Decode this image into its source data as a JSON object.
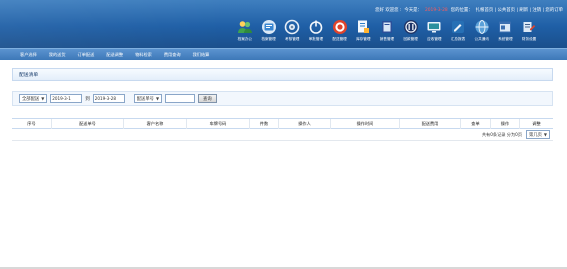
{
  "header": {
    "top_links": [
      {
        "text": "您好 欢迎您 :",
        "accent": false
      },
      {
        "text": "今天是：",
        "accent": false
      },
      {
        "text": "2019-3-28",
        "accent": true
      },
      {
        "text": "您的位置：",
        "accent": false
      },
      {
        "text": "扎根首页 | 公共首页 | 刷新 | 注销 | 您的订单",
        "accent": false
      }
    ],
    "toolbar": [
      {
        "label": "档案办公",
        "icon": "users-icon",
        "color": "#3fa34d"
      },
      {
        "label": "档案管理",
        "icon": "folder-icon",
        "color": "#3a86d1"
      },
      {
        "label": "考核管理",
        "icon": "gear-icon",
        "color": "#6b86a3"
      },
      {
        "label": "审批管理",
        "icon": "power-icon",
        "color": "#46648a"
      },
      {
        "label": "配送管理",
        "icon": "target-icon",
        "color": "#e0442c"
      },
      {
        "label": "库存管理",
        "icon": "document-icon",
        "color": "#2e7ec9"
      },
      {
        "label": "销售管理",
        "icon": "book-icon",
        "color": "#2a4f9a"
      },
      {
        "label": "回款管理",
        "icon": "chart-icon",
        "color": "#2c3e75"
      },
      {
        "label": "应收管理",
        "icon": "monitor-icon",
        "color": "#2a8f9e"
      },
      {
        "label": "汇总报表",
        "icon": "pen-icon",
        "color": "#2770b5"
      },
      {
        "label": "公共通讯",
        "icon": "globe-icon",
        "color": "#5aa0d8"
      },
      {
        "label": "系统管理",
        "icon": "window-icon",
        "color": "#3b6fb0"
      },
      {
        "label": "财务设置",
        "icon": "settings-icon",
        "color": "#3d5f8c"
      }
    ]
  },
  "nav": {
    "items": [
      "客户选择",
      "我的送货",
      "订单配送",
      "配送调整",
      "物料检索",
      "费用查询",
      "我们结算"
    ]
  },
  "page": {
    "title": "配送清单"
  },
  "filter": {
    "status_select": "全部配送",
    "date_from": "2019-3-1",
    "date_separator": "到",
    "date_to": "2019-3-28",
    "field_select": "配送单号",
    "query_text": "",
    "query_button": "查询"
  },
  "table": {
    "columns": [
      "序号",
      "配送单号",
      "客户名称",
      "车牌号码",
      "件数",
      "操作人",
      "操作时间",
      "配送费用",
      "查单",
      "操作",
      "调整"
    ],
    "rows": []
  },
  "pager": {
    "summary": "共有0条记录 分为0页",
    "page_select": "第几页"
  }
}
